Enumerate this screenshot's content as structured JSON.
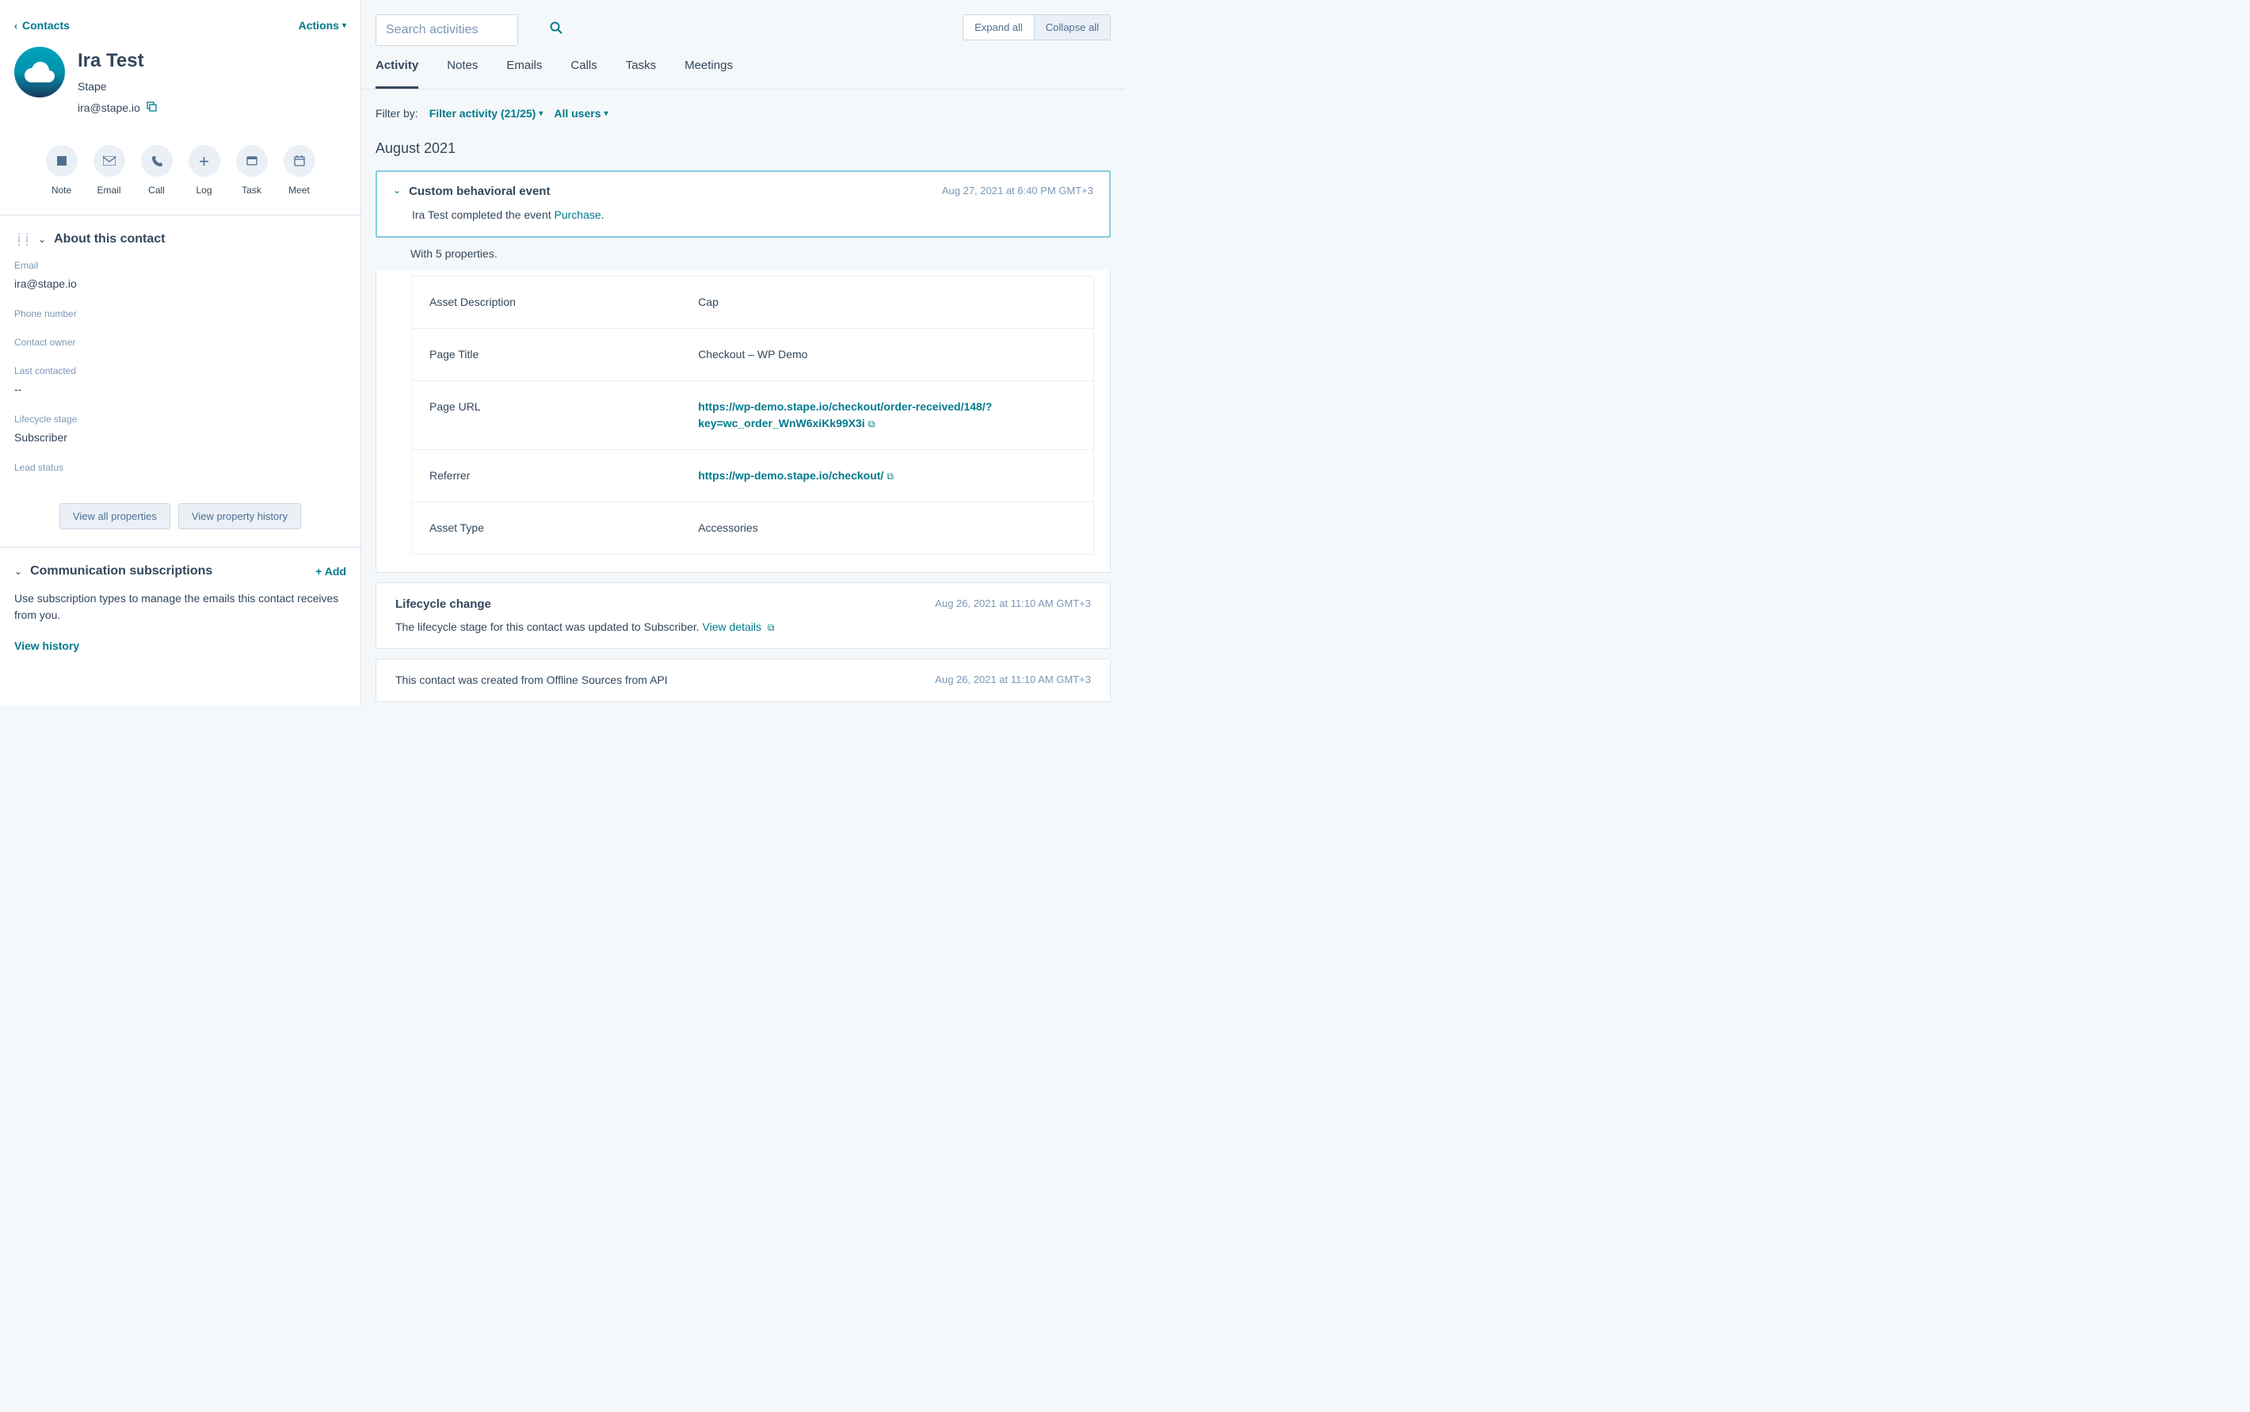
{
  "back_link": "Contacts",
  "actions_label": "Actions",
  "contact": {
    "name": "Ira Test",
    "company": "Stape",
    "email": "ira@stape.io"
  },
  "actions": {
    "note": "Note",
    "email": "Email",
    "call": "Call",
    "log": "Log",
    "task": "Task",
    "meet": "Meet"
  },
  "about": {
    "heading": "About this contact",
    "email_lbl": "Email",
    "email_val": "ira@stape.io",
    "phone_lbl": "Phone number",
    "phone_val": "",
    "owner_lbl": "Contact owner",
    "owner_val": "",
    "lastcontact_lbl": "Last contacted",
    "lastcontact_val": "--",
    "lifecycle_lbl": "Lifecycle stage",
    "lifecycle_val": "Subscriber",
    "leadstatus_lbl": "Lead status",
    "leadstatus_val": "",
    "view_all": "View all properties",
    "view_history": "View property history"
  },
  "comm": {
    "heading": "Communication subscriptions",
    "add": "+ Add",
    "desc": "Use subscription types to manage the emails this contact receives from you.",
    "view_history": "View history"
  },
  "search_placeholder": "Search activities",
  "expand_all": "Expand all",
  "collapse_all": "Collapse all",
  "tabs": {
    "activity": "Activity",
    "notes": "Notes",
    "emails": "Emails",
    "calls": "Calls",
    "tasks": "Tasks",
    "meetings": "Meetings"
  },
  "filter": {
    "label": "Filter by:",
    "activity": "Filter activity (21/25)",
    "users": "All users"
  },
  "month": "August 2021",
  "event_card": {
    "title": "Custom behavioral event",
    "time": "Aug 27, 2021 at 6:40 PM GMT+3",
    "text_pre": "Ira Test completed the event ",
    "text_link": "Purchase",
    "text_post": ".",
    "sub": "With 5 properties.",
    "rows": [
      {
        "k": "Asset Description",
        "v": "Cap",
        "link": false
      },
      {
        "k": "Page Title",
        "v": "Checkout – WP Demo",
        "link": false
      },
      {
        "k": "Page URL",
        "v": "https://wp-demo.stape.io/checkout/order-received/148/?key=wc_order_WnW6xiKk99X3i",
        "link": true
      },
      {
        "k": "Referrer",
        "v": "https://wp-demo.stape.io/checkout/",
        "link": true
      },
      {
        "k": "Asset Type",
        "v": "Accessories",
        "link": false
      }
    ]
  },
  "lifecycle_card": {
    "title": "Lifecycle change",
    "time": "Aug 26, 2021 at 11:10 AM GMT+3",
    "text": "The lifecycle stage for this contact was updated to Subscriber. ",
    "link": "View details"
  },
  "source_card": {
    "text": "This contact was created from Offline Sources from API",
    "time": "Aug 26, 2021 at 11:10 AM GMT+3"
  }
}
